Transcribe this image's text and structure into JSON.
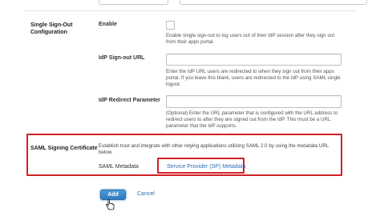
{
  "single_sign_out": {
    "section_label": "Single Sign-Out Configuration",
    "enable_label": "Enable",
    "enable_help": "Enable single sign-out to log users out of their IdP session after they sign out from their apps portal.",
    "idp_signout_url_label": "IdP Sign-out URL",
    "idp_signout_url_value": "",
    "idp_signout_url_help": "Enter the IdP URL users are redirected to when they sign out from their apps portal. If you leave this blank, users are redirected to the IdP using SAML single logout.",
    "idp_redirect_param_label": "IdP Redirect Parameter",
    "idp_redirect_param_help": "(Optional) Enter the URL parameter that is configured with the URL address to redirect users to after they are signed out from the IdP. This must be a URL parameter that the IdP supports."
  },
  "saml_signing": {
    "section_label": "SAML Signing Certificate",
    "description": "Establish trust and integrate with other relying applications utilizing SAML 2.0 by using the metadata URL below.",
    "metadata_label": "SAML Metadata",
    "metadata_link": "Service Provider (SP) Metadata"
  },
  "actions": {
    "add_label": "Add",
    "cancel_label": "Cancel"
  },
  "colors": {
    "highlight": "#d22027",
    "link": "#2a6fb5",
    "primary_button": "#2f7bc2"
  }
}
